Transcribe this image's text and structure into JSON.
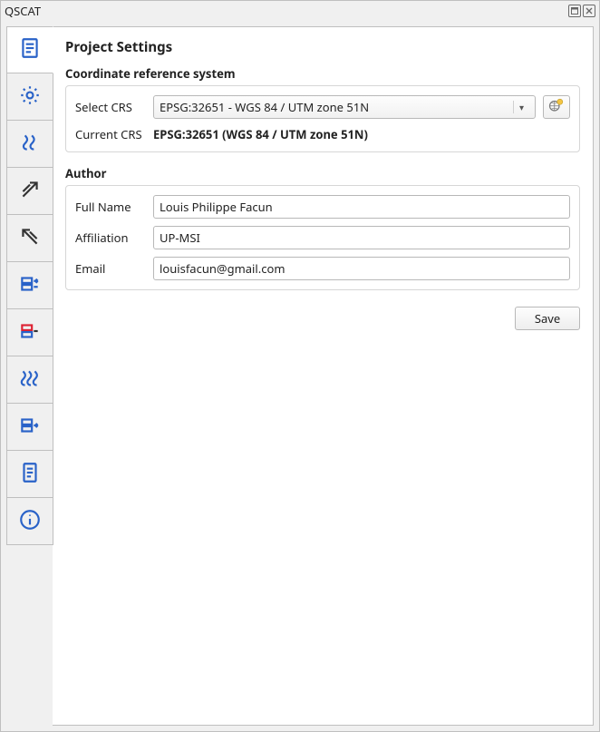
{
  "window": {
    "title": "QSCAT"
  },
  "sidebar": {
    "items": [
      {
        "name": "project-settings",
        "icon": "document-list-icon",
        "color": "blue",
        "active": true
      },
      {
        "name": "general-settings",
        "icon": "gear-icon",
        "color": "blue"
      },
      {
        "name": "waves-right",
        "icon": "waves-right-icon",
        "color": "blue"
      },
      {
        "name": "arrow-up-right",
        "icon": "arrow-up-right-icon",
        "color": "black"
      },
      {
        "name": "arrow-up-left",
        "icon": "arrow-up-left-icon",
        "color": "black"
      },
      {
        "name": "layers-a",
        "icon": "layers-right-icon",
        "color": "blue"
      },
      {
        "name": "layers-b",
        "icon": "layers-compare-icon",
        "color": "mixed"
      },
      {
        "name": "waves-many",
        "icon": "waves-many-icon",
        "color": "blue"
      },
      {
        "name": "layers-c",
        "icon": "layers-right-alt-icon",
        "color": "blue"
      },
      {
        "name": "report",
        "icon": "report-icon",
        "color": "blue"
      },
      {
        "name": "info",
        "icon": "info-icon",
        "color": "blue"
      }
    ]
  },
  "page": {
    "title": "Project Settings"
  },
  "crs": {
    "group_label": "Coordinate reference system",
    "select_label": "Select CRS",
    "selected": "EPSG:32651 - WGS 84 / UTM zone 51N",
    "current_label": "Current CRS",
    "current_value": "EPSG:32651 (WGS 84 / UTM zone 51N)"
  },
  "author": {
    "group_label": "Author",
    "fullname_label": "Full Name",
    "fullname_value": "Louis Philippe Facun",
    "affiliation_label": "Affiliation",
    "affiliation_value": "UP-MSI",
    "email_label": "Email",
    "email_value": "louisfacun@gmail.com"
  },
  "buttons": {
    "save": "Save"
  }
}
